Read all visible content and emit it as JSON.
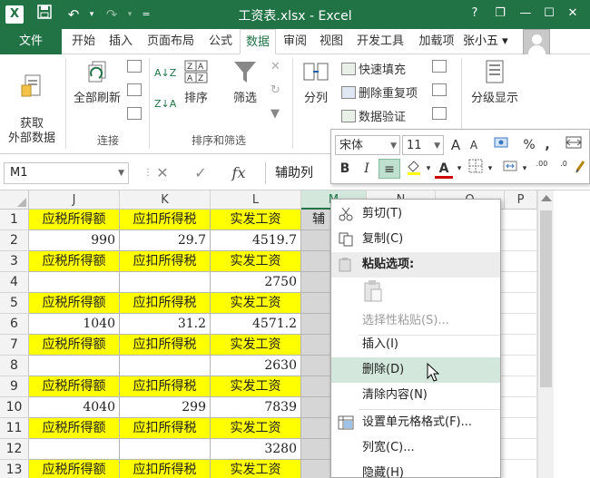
{
  "window": {
    "app_logo": "X",
    "title": "工资表.xlsx - Excel",
    "controls": {
      "help": "?",
      "restore": "❐",
      "minimize": "—",
      "maximize": "☐",
      "close": "✕"
    }
  },
  "tabs": {
    "file": "文件",
    "items": [
      "开始",
      "插入",
      "页面布局",
      "公式",
      "数据",
      "审阅",
      "视图",
      "开发工具",
      "加载项"
    ],
    "active_index": 4,
    "user": "张小五 ▾"
  },
  "ribbon": {
    "get_external_data": "获取\n外部数据",
    "refresh_all": "全部刷新",
    "sort_asc": "A↓Z",
    "sort": "排序",
    "filter": "筛选",
    "split": "分列",
    "flash_fill": "快速填充",
    "remove_duplicates": "删除重复项",
    "data_validation": "数据验证",
    "outline": "分级显示",
    "groups": {
      "connections": "连接",
      "sort_filter": "排序和筛选"
    }
  },
  "formula_bar": {
    "name_box": "M1",
    "fx": "fx",
    "value": "辅助列"
  },
  "grid": {
    "columns": [
      "J",
      "K",
      "L",
      "M",
      "N",
      "O",
      "P"
    ],
    "selected_column": "M",
    "row_numbers": [
      "1",
      "2",
      "3",
      "4",
      "5",
      "6",
      "7",
      "8",
      "9",
      "10",
      "11",
      "12",
      "13"
    ],
    "header_labels": [
      "应税所得额",
      "应扣所得税",
      "实发工资"
    ],
    "m1_value": "辅",
    "values": {
      "2": [
        "990",
        "29.7",
        "4519.7"
      ],
      "4": [
        "",
        "",
        "2750"
      ],
      "6": [
        "1040",
        "31.2",
        "4571.2"
      ],
      "8": [
        "",
        "",
        "2630"
      ],
      "10": [
        "4040",
        "299",
        "7839"
      ],
      "12": [
        "",
        "",
        "3280"
      ]
    }
  },
  "mini_toolbar": {
    "font": "宋体",
    "size": "11",
    "increase_font": "A",
    "decrease_font": "A",
    "percent": "%",
    "comma": ",",
    "bold": "B",
    "italic": "I",
    "font_color_letter": "A",
    "increase_decimal": ".00",
    "decrease_decimal": ".0"
  },
  "context_menu": {
    "cut": "剪切(T)",
    "copy": "复制(C)",
    "paste_options": "粘贴选项:",
    "paste_special": "选择性粘贴(S)...",
    "insert": "插入(I)",
    "delete": "删除(D)",
    "clear": "清除内容(N)",
    "format_cells": "设置单元格格式(F)...",
    "column_width": "列宽(C)...",
    "hide": "隐藏(H)"
  },
  "colors": {
    "excel_green": "#217346",
    "header_yellow": "#ffff00",
    "hover_green": "#d3e7dc"
  }
}
